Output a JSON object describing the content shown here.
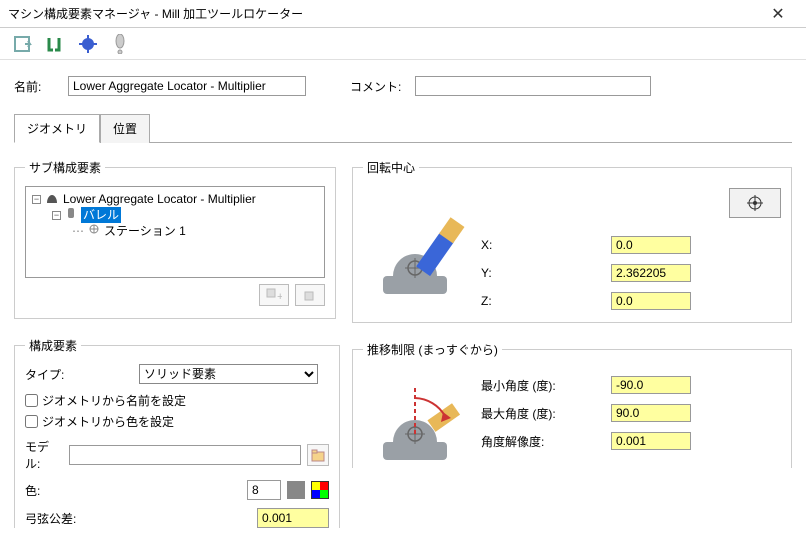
{
  "window": {
    "title": "マシン構成要素マネージャ - Mill 加工ツールロケーター"
  },
  "header": {
    "name_label": "名前:",
    "name_value": "Lower Aggregate Locator - Multiplier",
    "comment_label": "コメント:",
    "comment_value": ""
  },
  "tabs": {
    "geometry": "ジオメトリ",
    "position": "位置"
  },
  "sub": {
    "legend": "サブ構成要素",
    "root": "Lower Aggregate Locator - Multiplier",
    "barrel": "バレル",
    "station": "ステーション 1"
  },
  "geom": {
    "legend": "構成要素",
    "type_label": "タイプ:",
    "type_value": "ソリッド要素",
    "set_name_from_geom": "ジオメトリから名前を設定",
    "set_color_from_geom": "ジオメトリから色を設定",
    "model_label": "モデル:",
    "model_value": "",
    "color_label": "色:",
    "color_value": "8",
    "chord_label": "弓弦公差:",
    "chord_value": "0.001"
  },
  "rot": {
    "legend": "回転中心",
    "x_label": "X:",
    "x_value": "0.0",
    "y_label": "Y:",
    "y_value": "2.362205",
    "z_label": "Z:",
    "z_value": "0.0"
  },
  "trav": {
    "legend": "推移制限 (まっすぐから)",
    "min_label": "最小角度 (度):",
    "min_value": "-90.0",
    "max_label": "最大角度 (度):",
    "max_value": "90.0",
    "res_label": "角度解像度:",
    "res_value": "0.001"
  }
}
